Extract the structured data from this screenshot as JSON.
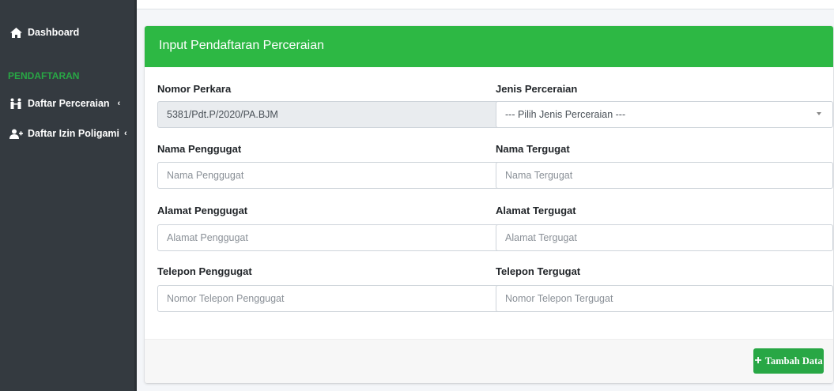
{
  "sidebar": {
    "dashboard_label": "Dashboard",
    "section_header": "PENDAFTARAN",
    "items": [
      {
        "label": "Daftar Perceraian",
        "icon": "couple-icon",
        "chevron": "‹"
      },
      {
        "label": "Daftar Izin Poligami",
        "icon": "user-plus-icon",
        "chevron": "‹"
      }
    ]
  },
  "card": {
    "title": "Input Pendaftaran Perceraian",
    "header_color": "#2db844"
  },
  "form": {
    "nomor_perkara": {
      "label": "Nomor Perkara",
      "value": "5381/Pdt.P/2020/PA.BJM"
    },
    "jenis_perceraian": {
      "label": "Jenis Perceraian",
      "value": "--- Pilih Jenis Perceraian ---"
    },
    "nama_penggugat": {
      "label": "Nama Penggugat",
      "placeholder": "Nama Penggugat"
    },
    "nama_tergugat": {
      "label": "Nama Tergugat",
      "placeholder": "Nama Tergugat"
    },
    "alamat_penggugat": {
      "label": "Alamat Penggugat",
      "placeholder": "Alamat Penggugat"
    },
    "alamat_tergugat": {
      "label": "Alamat Tergugat",
      "placeholder": "Alamat Tergugat"
    },
    "telepon_penggugat": {
      "label": "Telepon Penggugat",
      "placeholder": "Nomor Telepon Penggugat"
    },
    "telepon_tergugat": {
      "label": "Telepon Tergugat",
      "placeholder": "Nomor Telepon Tergugat"
    }
  },
  "footer": {
    "submit_label": "Tambah Data",
    "submit_icon": "plus-icon",
    "submit_color": "#28a745"
  }
}
